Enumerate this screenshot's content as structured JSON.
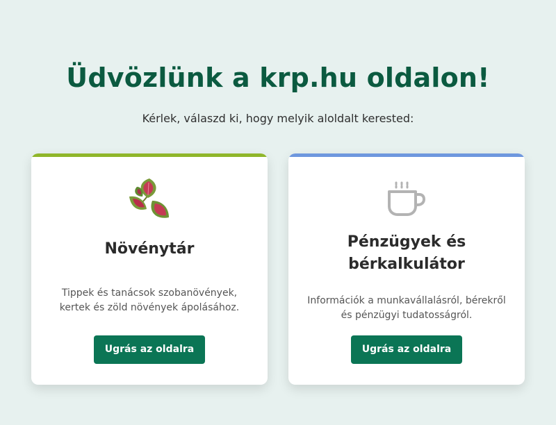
{
  "header": {
    "title": "Üdvözlünk a krp.hu oldalon!",
    "subtitle": "Kérlek, válaszd ki, hogy melyik aloldalt kerested:"
  },
  "cards": [
    {
      "icon": "coleus-plant-icon",
      "accent_color": "#8fb62a",
      "title": "Növénytár",
      "description": "Tippek és tanácsok szobanövények, kertek és zöld növények ápolásához.",
      "button_label": "Ugrás az oldalra"
    },
    {
      "icon": "coffee-cup-icon",
      "accent_color": "#6e97de",
      "title": "Pénzügyek és bérkalkulátor",
      "description": "Információk a munkavállalásról, bérekről és pénzügyi tudatosságról.",
      "button_label": "Ugrás az oldalra"
    }
  ],
  "colors": {
    "background": "#e7f1ef",
    "title": "#0b5a40",
    "button": "#0b7555"
  }
}
